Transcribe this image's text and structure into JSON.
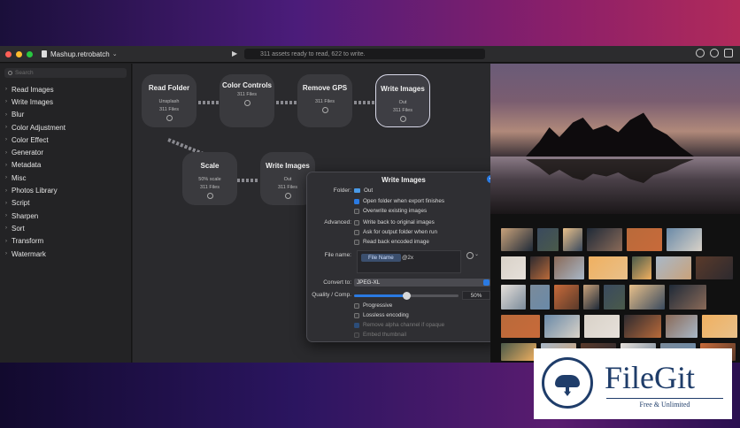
{
  "window": {
    "title": "Mashup.retrobatch",
    "status": "311 assets ready to read, 622 to write."
  },
  "sidebar": {
    "search_placeholder": "Search",
    "items": [
      {
        "label": "Read Images"
      },
      {
        "label": "Write Images"
      },
      {
        "label": "Blur"
      },
      {
        "label": "Color Adjustment"
      },
      {
        "label": "Color Effect"
      },
      {
        "label": "Generator"
      },
      {
        "label": "Metadata"
      },
      {
        "label": "Misc"
      },
      {
        "label": "Photos Library"
      },
      {
        "label": "Script"
      },
      {
        "label": "Sharpen"
      },
      {
        "label": "Sort"
      },
      {
        "label": "Transform"
      },
      {
        "label": "Watermark"
      }
    ]
  },
  "nodes": [
    {
      "title": "Read Folder",
      "sub": "Unsplash",
      "count": "311 Files"
    },
    {
      "title": "Color Controls",
      "sub": "",
      "count": "311 Files"
    },
    {
      "title": "Remove GPS",
      "sub": "",
      "count": "311 Files"
    },
    {
      "title": "Write Images",
      "sub": "Out",
      "count": "311 Files"
    },
    {
      "title": "Scale",
      "sub": "50% scale",
      "count": "311 Files"
    },
    {
      "title": "Write Images",
      "sub": "Out",
      "count": "311 Files"
    }
  ],
  "popover": {
    "title": "Write Images",
    "folder_label": "Folder:",
    "folder_value": "Out",
    "open_folder": "Open folder when export finishes",
    "overwrite": "Overwrite existing images",
    "advanced_label": "Advanced:",
    "write_back": "Write back to original images",
    "ask_output": "Ask for output folder when run",
    "read_back": "Read back encoded image",
    "filename_label": "File name:",
    "filename_token": "File Name",
    "filename_suffix": "@2x",
    "convert_label": "Convert to:",
    "convert_value": "JPEG-XL",
    "quality_label": "Quality / Comp.",
    "quality_value": "50%",
    "quality_fraction": 0.5,
    "progressive": "Progressive",
    "lossless": "Lossless encoding",
    "remove_alpha": "Remove alpha channel if opaque",
    "embed_thumb": "Embed thumbnail"
  },
  "watermark": {
    "name": "FileGit",
    "tagline": "Free & Unlimited"
  },
  "colors": {
    "accent": "#2a7ae2",
    "close": "#ff5f57",
    "minimize": "#febc2e",
    "zoom": "#28c840"
  }
}
